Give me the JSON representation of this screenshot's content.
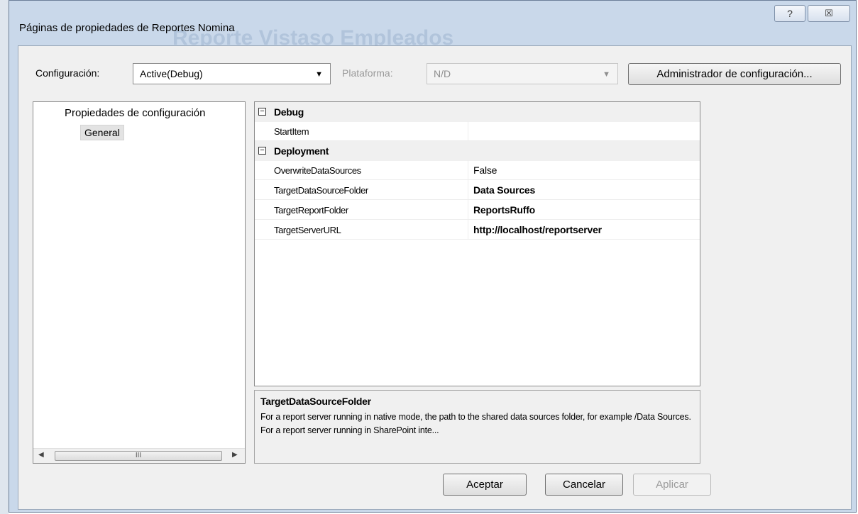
{
  "window": {
    "title": "Páginas de propiedades de Reportes Nomina",
    "background_title": "Reporte Vistaso Empleados",
    "help_button": "?",
    "close_button": "☒"
  },
  "toolbar": {
    "configuration_label": "Configuración:",
    "configuration_value": "Active(Debug)",
    "platform_label": "Plataforma:",
    "platform_value": "N/D",
    "config_manager_button": "Administrador de configuración..."
  },
  "tree": {
    "root_label": "Propiedades de configuración",
    "selected_item": "General",
    "scroll_thumb_grip": "III"
  },
  "grid": {
    "categories": [
      {
        "name": "Debug",
        "expander": "⊟",
        "properties": [
          {
            "name": "StartItem",
            "value": "",
            "bold": false
          }
        ]
      },
      {
        "name": "Deployment",
        "expander": "⊟",
        "properties": [
          {
            "name": "OverwriteDataSources",
            "value": "False",
            "bold": false
          },
          {
            "name": "TargetDataSourceFolder",
            "value": "Data Sources",
            "bold": true
          },
          {
            "name": "TargetReportFolder",
            "value": "ReportsRuffo",
            "bold": true
          },
          {
            "name": "TargetServerURL",
            "value": "http://localhost/reportserver",
            "bold": true
          }
        ]
      }
    ]
  },
  "help": {
    "title": "TargetDataSourceFolder",
    "description": "For a report server running in native mode, the path to the shared data sources folder, for example /Data Sources.  For a report server running in SharePoint inte..."
  },
  "buttons": {
    "ok": "Aceptar",
    "cancel": "Cancelar",
    "apply": "Aplicar"
  },
  "colors": {
    "dialog_frame": "#c9d8ea",
    "client_background": "#f0f0f0",
    "category_row": "#f0f0f0"
  }
}
